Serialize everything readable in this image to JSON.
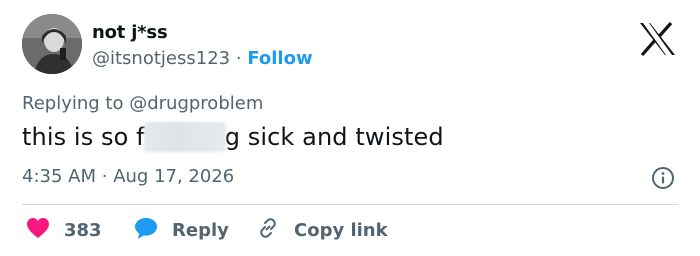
{
  "author": {
    "display_name": "not j*ss",
    "handle": "@itsnotjess123",
    "separator": "·",
    "follow_label": "Follow"
  },
  "reply_context": {
    "prefix": "Replying to",
    "mention": "@drugproblem"
  },
  "tweet": {
    "text_before": "this is so f",
    "text_after": "g sick and twisted"
  },
  "meta": {
    "time": "4:35 AM",
    "separator": "·",
    "date": "Aug 17, 2026"
  },
  "actions": {
    "like_count": "383",
    "reply_label": "Reply",
    "copy_label": "Copy link"
  },
  "colors": {
    "accent": "#1d9bf0",
    "like": "#f91880",
    "reply_icon": "#1d9bf0",
    "muted": "#536471",
    "text": "#0f1419"
  },
  "icons": {
    "brand": "x-logo-icon",
    "info": "info-icon",
    "like": "heart-icon",
    "reply": "speech-bubble-icon",
    "copy": "link-icon"
  }
}
